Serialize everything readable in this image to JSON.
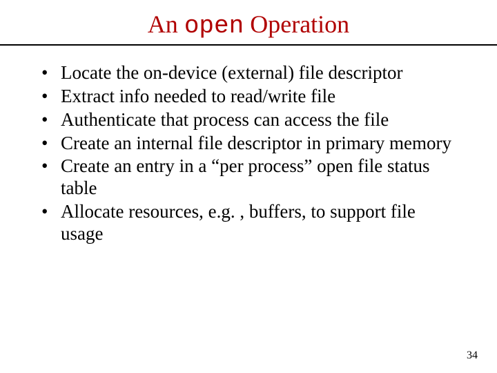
{
  "title": {
    "pre": "An ",
    "mono": "open",
    "post": " Operation"
  },
  "bullets": [
    "Locate the on-device (external) file descriptor",
    "Extract info needed to read/write file",
    "Authenticate that process can access the file",
    "Create an internal file descriptor in primary memory",
    "Create an entry in a “per process” open file status table",
    "Allocate resources, e.g. , buffers, to support file usage"
  ],
  "page_number": "34"
}
